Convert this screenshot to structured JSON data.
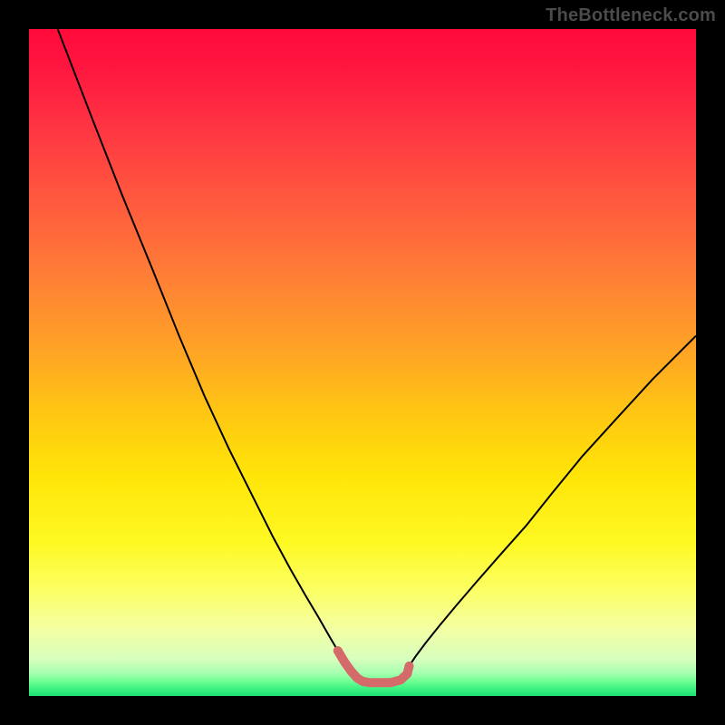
{
  "watermark": {
    "text": "TheBottleneck.com"
  },
  "chart_data": {
    "type": "line",
    "title": "",
    "xlabel": "",
    "ylabel": "",
    "xlim": [
      0,
      100
    ],
    "ylim": [
      0,
      100
    ],
    "grid": false,
    "legend": false,
    "background_gradient": {
      "stops": [
        {
          "pos": 0.0,
          "color": "#ff0a3a"
        },
        {
          "pos": 0.06,
          "color": "#ff1740"
        },
        {
          "pos": 0.16,
          "color": "#ff3942"
        },
        {
          "pos": 0.26,
          "color": "#ff5a3e"
        },
        {
          "pos": 0.37,
          "color": "#ff7e36"
        },
        {
          "pos": 0.48,
          "color": "#ffa326"
        },
        {
          "pos": 0.58,
          "color": "#ffc812"
        },
        {
          "pos": 0.67,
          "color": "#ffe508"
        },
        {
          "pos": 0.77,
          "color": "#fef923"
        },
        {
          "pos": 0.84,
          "color": "#fcff63"
        },
        {
          "pos": 0.9,
          "color": "#f3ffa3"
        },
        {
          "pos": 0.945,
          "color": "#d7ffbe"
        },
        {
          "pos": 0.965,
          "color": "#a7ffaf"
        },
        {
          "pos": 0.978,
          "color": "#6fff93"
        },
        {
          "pos": 0.988,
          "color": "#40f382"
        },
        {
          "pos": 1.0,
          "color": "#1fe172"
        }
      ]
    },
    "series": [
      {
        "name": "curve",
        "color": "#000000",
        "width": 2.0,
        "x": [
          4.3,
          9.5,
          14.0,
          18.5,
          22.5,
          26.3,
          30.0,
          33.5,
          36.5,
          39.2,
          41.5,
          43.4,
          45.0,
          46.3,
          47.3,
          48.3,
          49.2,
          50.0,
          51.0,
          52.5,
          54.2,
          55.7,
          56.7,
          57.0,
          58.0,
          59.5,
          61.5,
          64.0,
          67.0,
          70.5,
          74.5,
          78.5,
          83.0,
          88.0,
          93.5,
          100.0
        ],
        "y": [
          100.0,
          86.5,
          75.0,
          64.0,
          54.0,
          45.0,
          37.0,
          30.0,
          24.0,
          19.0,
          15.0,
          11.8,
          9.0,
          6.8,
          5.1,
          3.7,
          2.7,
          2.2,
          2.0,
          2.0,
          2.0,
          2.4,
          3.3,
          4.5,
          6.0,
          8.0,
          10.5,
          13.5,
          17.0,
          21.0,
          25.5,
          30.5,
          36.0,
          41.5,
          47.5,
          54.0
        ]
      },
      {
        "name": "highlight",
        "color": "#d46a6a",
        "width": 10.0,
        "linecap": "round",
        "x": [
          46.3,
          47.3,
          48.3,
          49.2,
          50.0,
          51.0,
          52.5,
          54.2,
          55.7,
          56.7,
          57.0
        ],
        "y": [
          6.8,
          5.1,
          3.7,
          2.7,
          2.2,
          2.0,
          2.0,
          2.0,
          2.4,
          3.3,
          4.5
        ]
      }
    ]
  }
}
